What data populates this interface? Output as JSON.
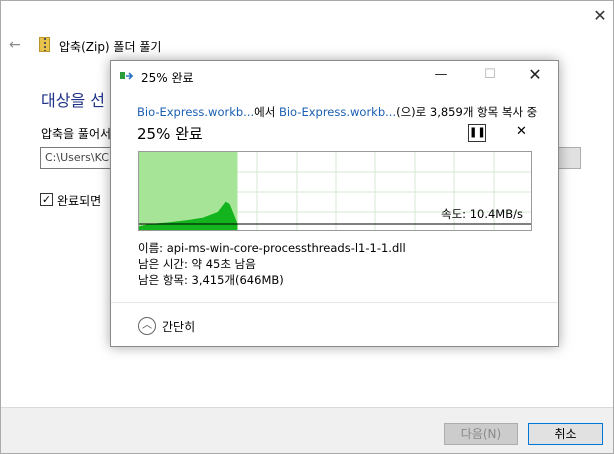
{
  "wizard": {
    "title": "압축(Zip) 폴더 풀기",
    "heading": "대상을 선",
    "extract_label": "압축을 풀어서",
    "path_value": "C:\\Users\\KC",
    "checkbox_label": "완료되면 \u0000",
    "next_label": "다음(N)",
    "cancel_label": "취소"
  },
  "dialog": {
    "title": "25% 완료",
    "source_link": "Bio-Express.workb...",
    "text_from": "에서 ",
    "dest_link": "Bio-Express.workb...",
    "text_copy": "(으)로 3,859개 항목 복사 중",
    "percent_label": "25% 완료",
    "speed_label": "속도: 10.4MB/s",
    "name_line": "이름: api-ms-win-core-processthreads-l1-1-1.dll",
    "time_line": "남은 시간: 약 45초 남음",
    "items_line": "남은 항목: 3,415개(646MB)",
    "collapse_label": "간단히"
  },
  "progress": {
    "fraction": 0.25,
    "fill_color": "#a6e597",
    "curve_color": "#14b41e"
  }
}
